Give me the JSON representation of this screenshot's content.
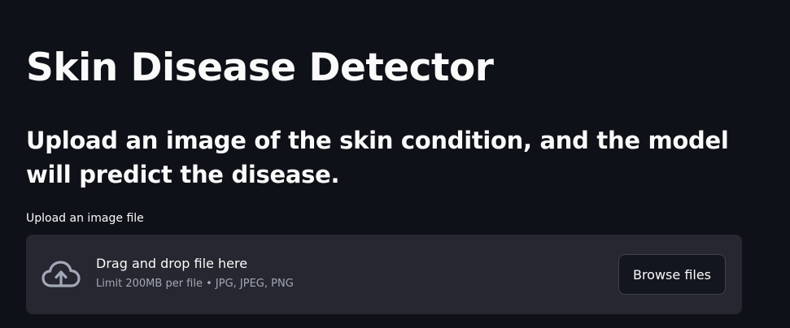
{
  "header": {
    "title": "Skin Disease Detector",
    "subtitle": "Upload an image of the skin condition, and the model will predict the disease."
  },
  "uploader": {
    "label": "Upload an image file",
    "drag_text": "Drag and drop file here",
    "limit_text": "Limit 200MB per file • JPG, JPEG, PNG",
    "browse_label": "Browse files",
    "icon": "cloud-upload-icon"
  },
  "colors": {
    "background": "#0e1117",
    "dropzone": "#262730",
    "text": "#fafafa",
    "muted_text": "#a3a8b8"
  }
}
